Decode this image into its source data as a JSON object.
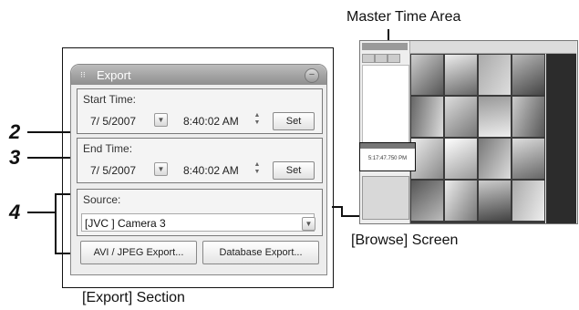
{
  "captions": {
    "master_time_area": "Master Time Area",
    "browse_screen": "[Browse] Screen",
    "export_section": "[Export] Section"
  },
  "callouts": [
    "2",
    "3",
    "4"
  ],
  "export_panel": {
    "title": "Export",
    "start_time": {
      "label": "Start Time:",
      "date": "7/ 5/2007",
      "time": "8:40:02 AM",
      "set_label": "Set"
    },
    "end_time": {
      "label": "End Time:",
      "date": "7/ 5/2007",
      "time": "8:40:02 AM",
      "set_label": "Set"
    },
    "source": {
      "label": "Source:",
      "value": "[JVC ] Camera 3"
    },
    "avi_button": "AVI / JPEG Export...",
    "database_button": "Database Export..."
  },
  "browse": {
    "master_time": "5:17:47.750 PM"
  },
  "colors": {
    "panel_title": "#9a9a9a",
    "panel_bg": "#ededed",
    "grid_bg": "#3b3b3b"
  }
}
